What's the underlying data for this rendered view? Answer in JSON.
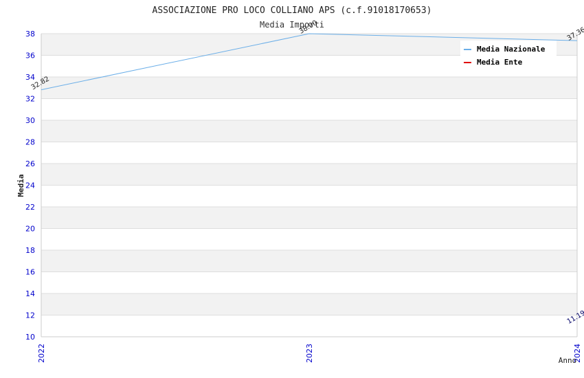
{
  "chart_data": {
    "type": "line",
    "title": "ASSOCIAZIONE PRO LOCO COLLIANO APS (c.f.91018170653)",
    "subtitle": "Media Importi",
    "xlabel": "Anno",
    "ylabel": "Media",
    "x": [
      "2022",
      "2023",
      "2024"
    ],
    "ylim": [
      10,
      38
    ],
    "yticks": [
      "10",
      "12",
      "14",
      "16",
      "18",
      "20",
      "22",
      "24",
      "26",
      "28",
      "30",
      "32",
      "34",
      "36",
      "38"
    ],
    "grid": true,
    "legend_position": "top-right",
    "series": [
      {
        "name": "Media Nazionale",
        "color": "#6aaee8",
        "values": [
          32.82,
          38.0,
          37.36
        ],
        "labels": [
          "32.82",
          "38.00",
          "37.36"
        ]
      },
      {
        "name": "Media Ente",
        "color": "#e00000",
        "values": [
          null,
          null,
          11.19
        ],
        "labels": [
          "",
          "",
          "11.19"
        ]
      }
    ],
    "colors": {
      "tick": "#0000cc",
      "band": "#f2f2f2",
      "grid": "#dddddd",
      "axis": "#cccccc"
    }
  }
}
